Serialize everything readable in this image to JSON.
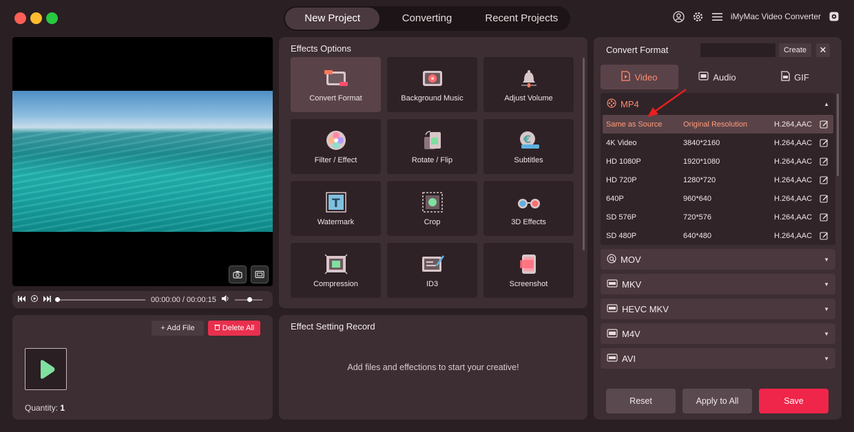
{
  "app": {
    "title": "iMyMac Video Converter",
    "nav_tabs": [
      "New Project",
      "Converting",
      "Recent Projects"
    ]
  },
  "player": {
    "time": "00:00:00 / 00:00:15"
  },
  "files": {
    "add_label": "Add File",
    "delete_label": "Delete All",
    "quantity_label": "Quantity:",
    "quantity_value": "1"
  },
  "effects": {
    "title": "Effects Options",
    "items": [
      {
        "label": "Convert Format",
        "icon": "convert-format-icon"
      },
      {
        "label": "Background Music",
        "icon": "music-icon"
      },
      {
        "label": "Adjust Volume",
        "icon": "bell-volume-icon"
      },
      {
        "label": "Filter / Effect",
        "icon": "filter-icon"
      },
      {
        "label": "Rotate / Flip",
        "icon": "rotate-icon"
      },
      {
        "label": "Subtitles",
        "icon": "subtitles-icon"
      },
      {
        "label": "Watermark",
        "icon": "watermark-icon"
      },
      {
        "label": "Crop",
        "icon": "crop-icon"
      },
      {
        "label": "3D Effects",
        "icon": "3d-glasses-icon"
      },
      {
        "label": "Compression",
        "icon": "compression-icon"
      },
      {
        "label": "ID3",
        "icon": "id3-icon"
      },
      {
        "label": "Screenshot",
        "icon": "screenshot-icon"
      }
    ]
  },
  "record": {
    "title": "Effect Setting Record",
    "empty_message": "Add files and effections to start your creative!"
  },
  "convert": {
    "title": "Convert Format",
    "create_label": "Create",
    "close_label": "✕",
    "tabs": [
      "Video",
      "Audio",
      "GIF"
    ],
    "mp4_label": "MP4",
    "presets": [
      {
        "name": "Same as Source",
        "res": "Original Resolution",
        "codec": "H.264,AAC"
      },
      {
        "name": "4K Video",
        "res": "3840*2160",
        "codec": "H.264,AAC"
      },
      {
        "name": "HD 1080P",
        "res": "1920*1080",
        "codec": "H.264,AAC"
      },
      {
        "name": "HD 720P",
        "res": "1280*720",
        "codec": "H.264,AAC"
      },
      {
        "name": "640P",
        "res": "960*640",
        "codec": "H.264,AAC"
      },
      {
        "name": "SD 576P",
        "res": "720*576",
        "codec": "H.264,AAC"
      },
      {
        "name": "SD 480P",
        "res": "640*480",
        "codec": "H.264,AAC"
      }
    ],
    "formats": [
      "MOV",
      "MKV",
      "HEVC MKV",
      "M4V",
      "AVI"
    ],
    "buttons": {
      "reset": "Reset",
      "apply": "Apply to All",
      "save": "Save"
    }
  },
  "colors": {
    "accent": "#f0254a",
    "highlight": "#ff8a6e",
    "background": "#2a1f23"
  }
}
